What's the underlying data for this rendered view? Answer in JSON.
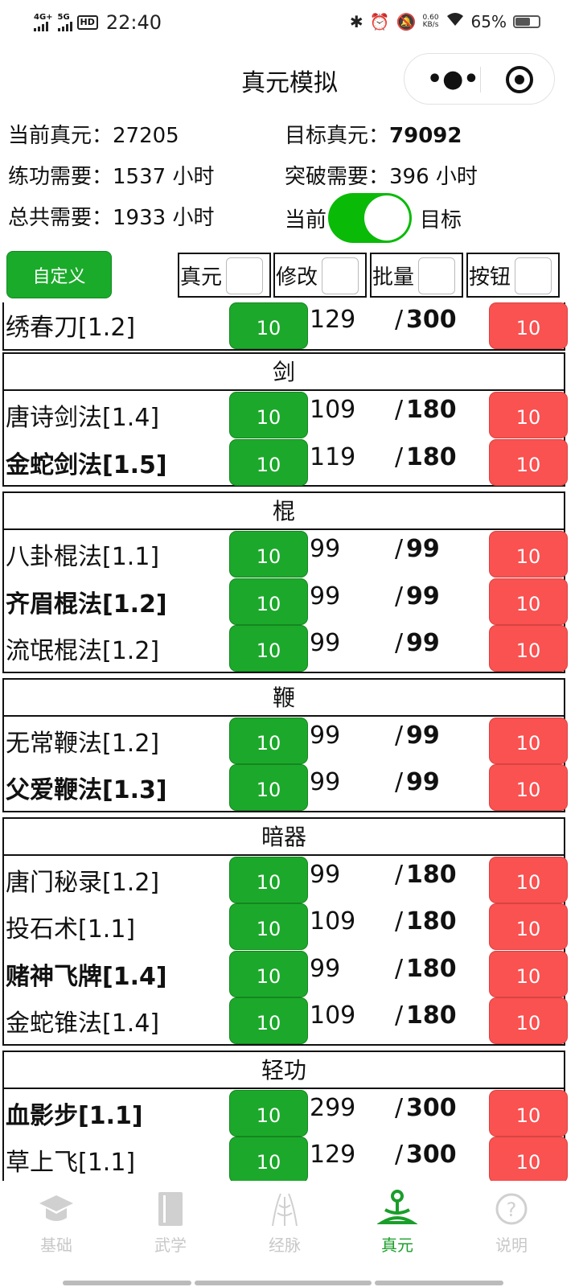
{
  "status_bar": {
    "network1": "4G+",
    "network2": "5G",
    "hd": "HD",
    "time": "22:40",
    "speed_value": "0.60",
    "speed_unit": "KB/s",
    "battery_pct": "65%",
    "battery_level": 0.65
  },
  "header": {
    "title": "真元模拟"
  },
  "info": {
    "current_label": "当前真元：",
    "current_value": "27205",
    "target_label": "目标真元：",
    "target_value": "79092",
    "practice_label": "练功需要：",
    "practice_value": "1537 小时",
    "breakthrough_label": "突破需要：",
    "breakthrough_value": "396 小时",
    "total_label": "总共需要：",
    "total_value": "1933 小时",
    "toggle_left": "当前",
    "toggle_right": "目标",
    "toggle_on": true
  },
  "controls": {
    "custom_button": "自定义",
    "field_zhenyuan": "真元",
    "field_modify": "修改",
    "field_batch": "批量",
    "field_button": "按钮"
  },
  "top_partial_row": {
    "name": "绣春刀[1.2]",
    "bold": false,
    "add": "10",
    "current": "129",
    "max": "300",
    "sub": "10"
  },
  "sections": [
    {
      "title": "剑",
      "rows": [
        {
          "name": "唐诗剑法[1.4]",
          "bold": false,
          "add": "10",
          "current": "109",
          "max": "180",
          "sub": "10"
        },
        {
          "name": "金蛇剑法[1.5]",
          "bold": true,
          "add": "10",
          "current": "119",
          "max": "180",
          "sub": "10"
        }
      ]
    },
    {
      "title": "棍",
      "rows": [
        {
          "name": "八卦棍法[1.1]",
          "bold": false,
          "add": "10",
          "current": "99",
          "max": "99",
          "sub": "10"
        },
        {
          "name": "齐眉棍法[1.2]",
          "bold": true,
          "add": "10",
          "current": "99",
          "max": "99",
          "sub": "10"
        },
        {
          "name": "流氓棍法[1.2]",
          "bold": false,
          "add": "10",
          "current": "99",
          "max": "99",
          "sub": "10"
        }
      ]
    },
    {
      "title": "鞭",
      "rows": [
        {
          "name": "无常鞭法[1.2]",
          "bold": false,
          "add": "10",
          "current": "99",
          "max": "99",
          "sub": "10"
        },
        {
          "name": "父爱鞭法[1.3]",
          "bold": true,
          "add": "10",
          "current": "99",
          "max": "99",
          "sub": "10"
        }
      ]
    },
    {
      "title": "暗器",
      "rows": [
        {
          "name": "唐门秘录[1.2]",
          "bold": false,
          "add": "10",
          "current": "99",
          "max": "180",
          "sub": "10"
        },
        {
          "name": "投石术[1.1]",
          "bold": false,
          "add": "10",
          "current": "109",
          "max": "180",
          "sub": "10"
        },
        {
          "name": "赌神飞牌[1.4]",
          "bold": true,
          "add": "10",
          "current": "99",
          "max": "180",
          "sub": "10"
        },
        {
          "name": "金蛇锥法[1.4]",
          "bold": false,
          "add": "10",
          "current": "109",
          "max": "180",
          "sub": "10"
        }
      ]
    },
    {
      "title": "轻功",
      "rows": [
        {
          "name": "血影步[1.1]",
          "bold": true,
          "add": "10",
          "current": "299",
          "max": "300",
          "sub": "10"
        },
        {
          "name": "草上飞[1.1]",
          "bold": false,
          "add": "10",
          "current": "129",
          "max": "300",
          "sub": "10"
        }
      ]
    }
  ],
  "tabs": [
    {
      "label": "基础",
      "icon": "graduation-cap-icon",
      "active": false
    },
    {
      "label": "武学",
      "icon": "book-icon",
      "active": false
    },
    {
      "label": "经脉",
      "icon": "body-meridian-icon",
      "active": false
    },
    {
      "label": "真元",
      "icon": "meditation-icon",
      "active": true
    },
    {
      "label": "说明",
      "icon": "help-icon",
      "active": false
    }
  ],
  "colors": {
    "green": "#1ca92b",
    "red": "#fa5151",
    "toggle": "#09bb07",
    "tab_active": "#1a9e2a",
    "tab_inactive": "#c8c8c8"
  }
}
